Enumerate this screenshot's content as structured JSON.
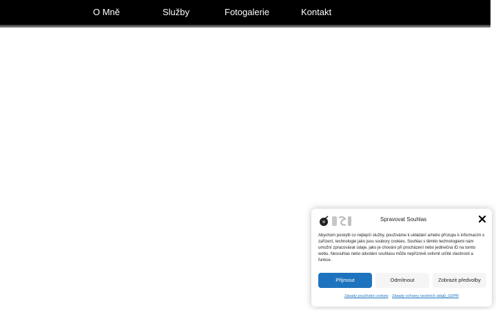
{
  "nav": {
    "items": [
      {
        "label": "O Mně"
      },
      {
        "label": "Služby"
      },
      {
        "label": "Fotogalerie"
      },
      {
        "label": "Kontakt"
      }
    ]
  },
  "cookie": {
    "logo_icon": "site-logo-icon",
    "title": "Spravovat Souhlas",
    "close_icon": "close-icon",
    "text": "Abychom poskytli co nejlepší služby, používáme k ukládání a/nebo přístupu k informacím o zařízení, technologie jako jsou soubory cookies. Souhlas s těmito technologiemi nám umožní zpracovávat údaje, jako je chování při procházení nebo jedinečná ID na tomto webu. Nesouhlas nebo odvolání souhlasu může nepříznivě ovlivnit určité vlastnosti a funkce.",
    "buttons": {
      "accept": "Přijmout",
      "deny": "Odmítnout",
      "preferences": "Zobrazit předvolby"
    },
    "links": {
      "cookie_policy": "Zásady používání cookies",
      "privacy_policy": "Zásady ochrany osobních údajů_GDPR"
    },
    "accent_color": "#1e73be"
  }
}
